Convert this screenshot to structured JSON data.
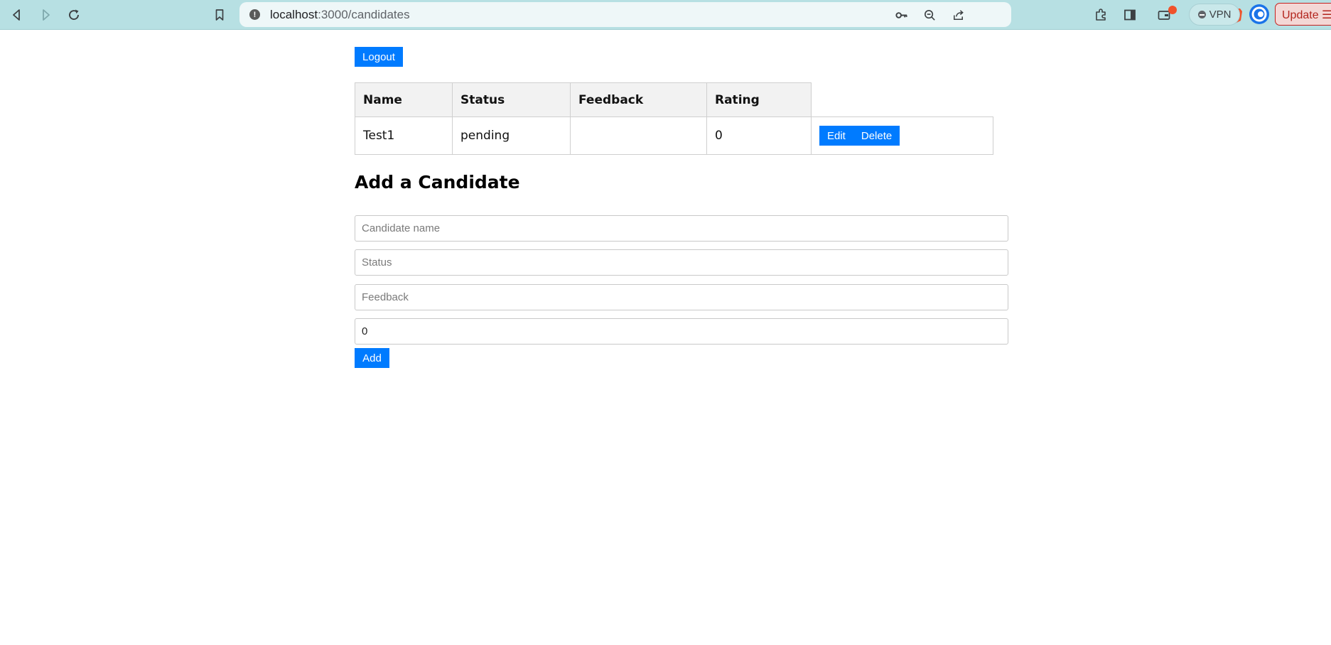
{
  "browser": {
    "url_host": "localhost",
    "url_path": ":3000/candidates",
    "vpn_label": "VPN",
    "update_label": "Update",
    "colors": {
      "chrome_bg": "#b7e0e3",
      "omnibox_bg": "#eef7f8",
      "brave_orange": "#f0522b"
    }
  },
  "page": {
    "logout_label": "Logout",
    "table": {
      "headers": [
        "Name",
        "Status",
        "Feedback",
        "Rating"
      ],
      "rows": [
        {
          "name": "Test1",
          "status": "pending",
          "feedback": "",
          "rating": "0",
          "edit_label": "Edit",
          "delete_label": "Delete"
        }
      ]
    },
    "form": {
      "title": "Add a Candidate",
      "name_placeholder": "Candidate name",
      "status_placeholder": "Status",
      "feedback_placeholder": "Feedback",
      "rating_value": "0",
      "add_label": "Add"
    },
    "colors": {
      "primary": "#007bff",
      "header_bg": "#f2f2f2"
    }
  }
}
